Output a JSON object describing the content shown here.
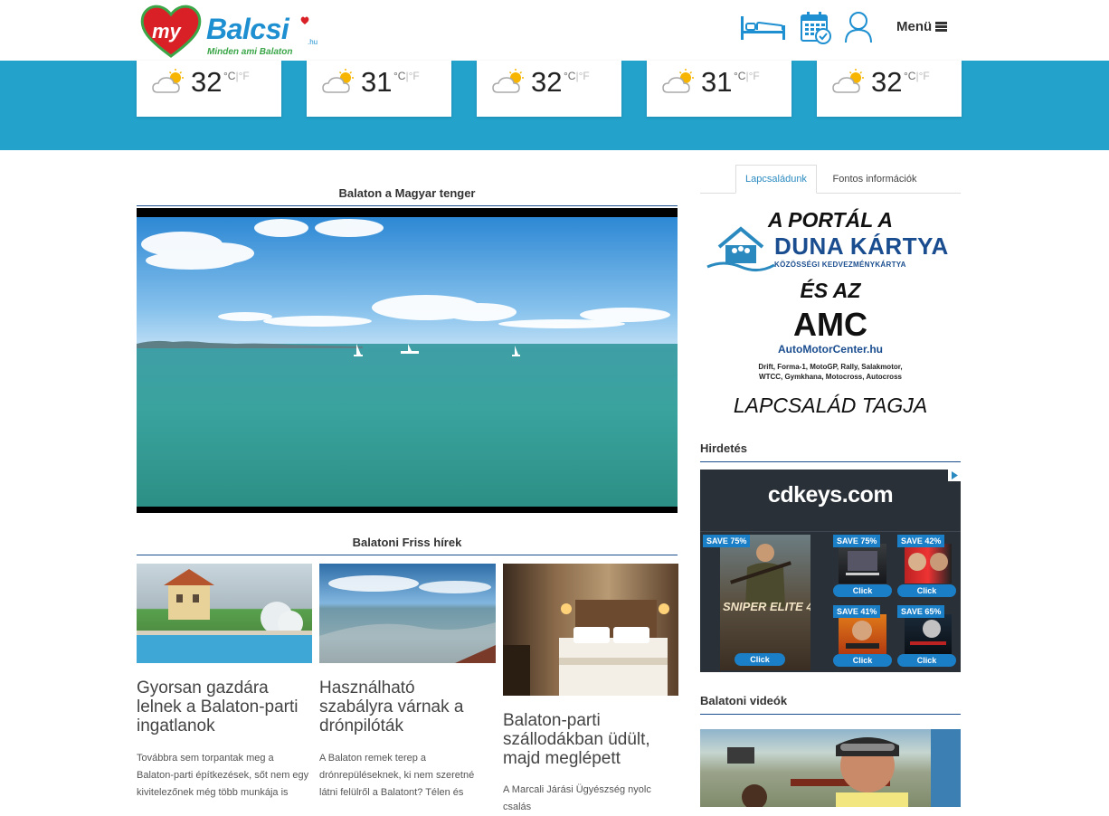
{
  "header": {
    "logo_my": "my",
    "logo_brand": "Balcsi",
    "logo_tld": ".hu",
    "logo_tagline": "Minden ami Balaton",
    "menu_label": "Menü",
    "accent_color": "#1e8fd0"
  },
  "weather": [
    {
      "temp": "32",
      "unit_c": "°C",
      "sep": "|",
      "unit_f": "°F"
    },
    {
      "temp": "31",
      "unit_c": "°C",
      "sep": "|",
      "unit_f": "°F"
    },
    {
      "temp": "32",
      "unit_c": "°C",
      "sep": "|",
      "unit_f": "°F"
    },
    {
      "temp": "31",
      "unit_c": "°C",
      "sep": "|",
      "unit_f": "°F"
    },
    {
      "temp": "32",
      "unit_c": "°C",
      "sep": "|",
      "unit_f": "°F"
    }
  ],
  "video_section": {
    "title": "Balaton a Magyar tenger"
  },
  "news_section": {
    "title": "Balatoni Friss hírek",
    "items": [
      {
        "title_lines": [
          "Gyorsan gazdára",
          "lelnek a Balaton-parti",
          "ingatlanok"
        ],
        "excerpt_lines": [
          "Továbbra sem torpantak meg a",
          "Balaton-parti építkezések, sőt nem egy",
          "kivitelezőnek még több munkája is"
        ]
      },
      {
        "title_lines": [
          "Használható",
          "szabályra várnak a",
          "drónpilóták"
        ],
        "excerpt_lines": [
          "A Balaton remek terep a",
          "drónrepüléseknek, ki nem szeretné",
          "látni felülről a Balatont? Télen és"
        ]
      },
      {
        "title_lines": [
          "Balaton-parti",
          "szállodákban üdült,",
          "majd meglépett"
        ],
        "excerpt_lines": [
          "A Marcali Járási Ügyészség nyolc csalás"
        ]
      }
    ]
  },
  "sidebar": {
    "tabs": [
      "Lapcsaládunk",
      "Fontos információk"
    ],
    "promo": {
      "line1": "A PORTÁL A",
      "duna": "DUNA KÁRTYA",
      "duna_sub": "KÖZÖSSÉGI KEDVEZMÉNYKÁRTYA",
      "es_az": "ÉS AZ",
      "amc": "AMC",
      "amc_url": "AutoMotorCenter.hu",
      "amc_sub": "Drift, Forma-1, MotoGP, Rally, Salakmotor, WTCC, Gymkhana, Motocross, Autocross",
      "tagja": "LAPCSALÁD TAGJA"
    },
    "ad_title": "Hirdetés",
    "ad": {
      "logo": "cdkeys.com",
      "tiles": [
        {
          "save": "SAVE 75%",
          "click": "Click",
          "game": "SNIPER ELITE 4"
        },
        {
          "save": "SAVE 75%",
          "click": "Click"
        },
        {
          "save": "SAVE 42%",
          "click": "Click"
        },
        {
          "save": "SAVE 41%",
          "click": "Click"
        },
        {
          "save": "SAVE 65%",
          "click": "Click"
        }
      ]
    },
    "videos_title": "Balatoni videók"
  }
}
